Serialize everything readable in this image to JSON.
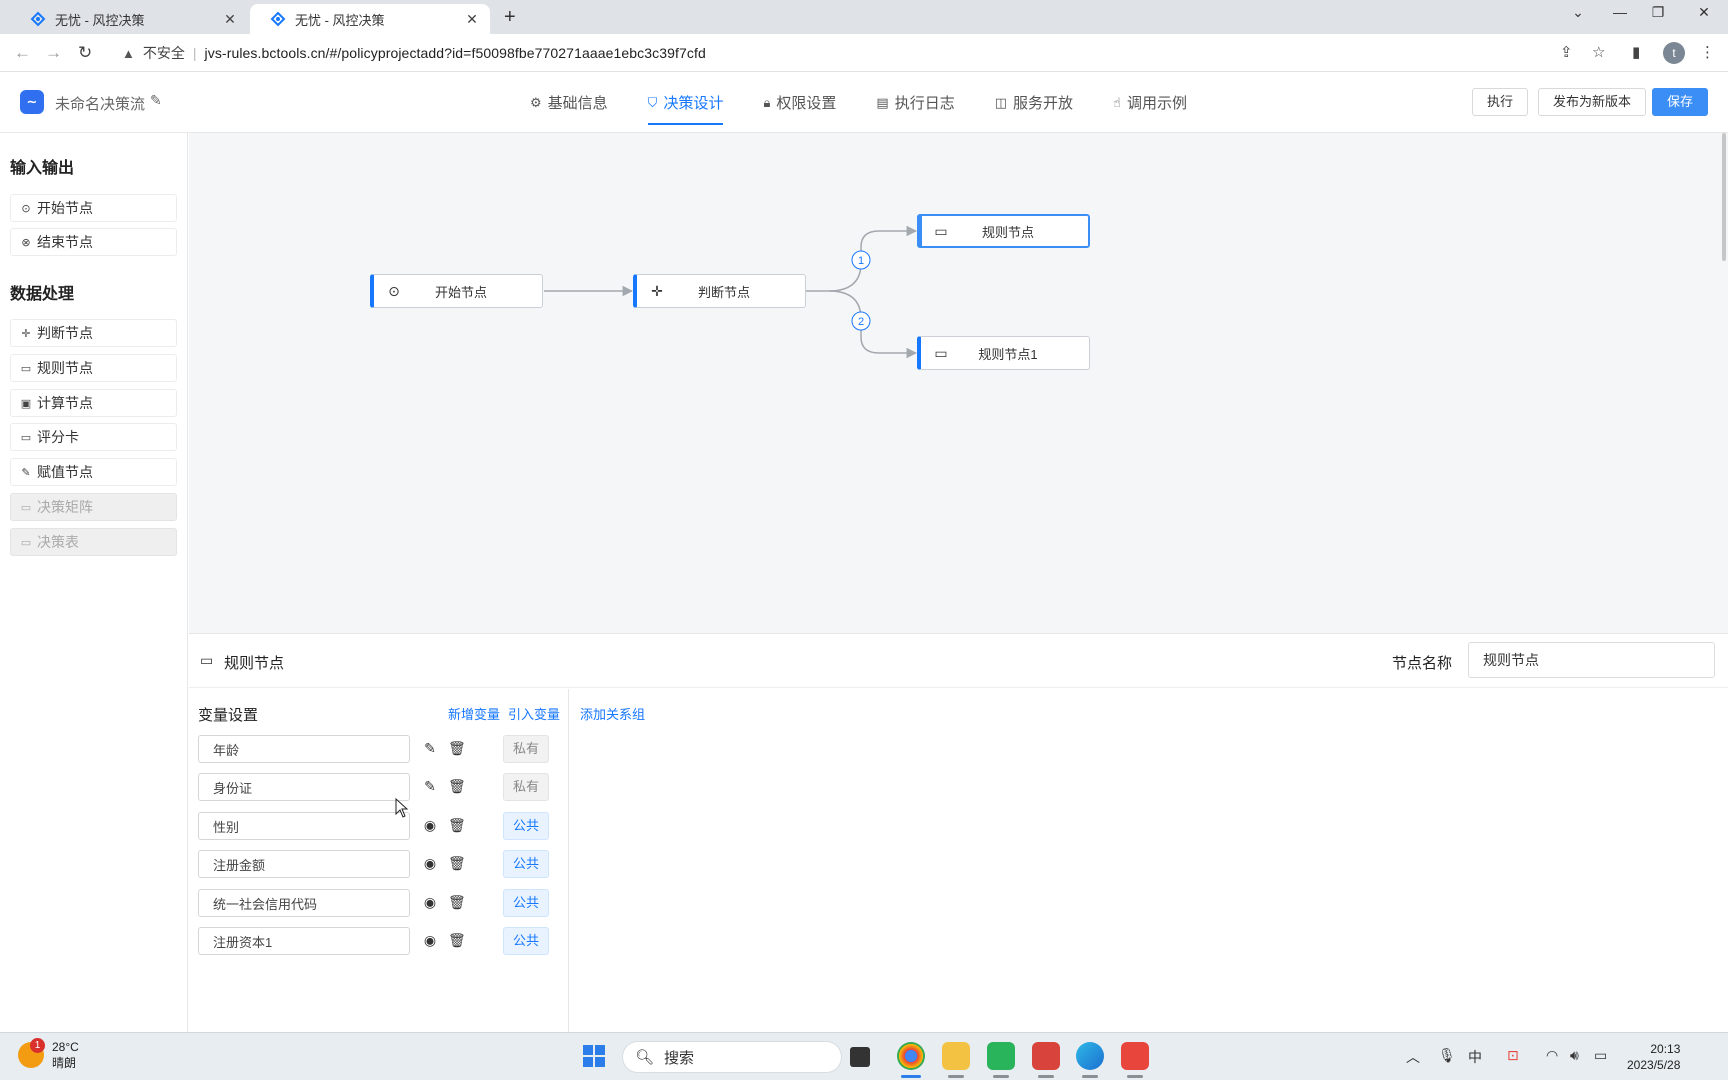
{
  "browser": {
    "tabs": [
      {
        "title": "无忧 - 风控决策",
        "active": false
      },
      {
        "title": "无忧 - 风控决策",
        "active": true
      }
    ],
    "new_tab": "+",
    "security": "不安全",
    "url": "jvs-rules.bctools.cn/#/policyprojectadd?id=f50098fbe770271aaae1ebc3c39f7cfd",
    "profile_initial": "t"
  },
  "header": {
    "logo": "∼",
    "title": "未命名决策流",
    "tabs": [
      {
        "label": "基础信息",
        "icon": "gear-icon",
        "active": false
      },
      {
        "label": "决策设计",
        "icon": "design-icon",
        "active": true
      },
      {
        "label": "权限设置",
        "icon": "lock-icon",
        "active": false
      },
      {
        "label": "执行日志",
        "icon": "doc-icon",
        "active": false
      },
      {
        "label": "服务开放",
        "icon": "book-icon",
        "active": false
      },
      {
        "label": "调用示例",
        "icon": "hand-icon",
        "active": false
      }
    ],
    "buttons": {
      "execute": "执行",
      "publish": "发布为新版本",
      "save": "保存"
    }
  },
  "palette": {
    "groups": [
      {
        "title": "输入输出",
        "items": [
          {
            "label": "开始节点",
            "icon": "play-circle-icon",
            "disabled": false
          },
          {
            "label": "结束节点",
            "icon": "close-circle-icon",
            "disabled": false
          }
        ]
      },
      {
        "title": "数据处理",
        "items": [
          {
            "label": "判断节点",
            "icon": "move-icon",
            "disabled": false
          },
          {
            "label": "规则节点",
            "icon": "card-icon",
            "disabled": false
          },
          {
            "label": "计算节点",
            "icon": "calculator-icon",
            "disabled": false
          },
          {
            "label": "评分卡",
            "icon": "card-icon",
            "disabled": false
          },
          {
            "label": "赋值节点",
            "icon": "edit-icon",
            "disabled": false
          },
          {
            "label": "决策矩阵",
            "icon": "card-icon",
            "disabled": true
          },
          {
            "label": "决策表",
            "icon": "card-icon",
            "disabled": true
          }
        ]
      }
    ]
  },
  "flow": {
    "nodes": [
      {
        "id": "start",
        "label": "开始节点",
        "icon": "play-circle-icon"
      },
      {
        "id": "judge",
        "label": "判断节点",
        "icon": "move-icon"
      },
      {
        "id": "rule",
        "label": "规则节点",
        "icon": "card-icon",
        "selected": true
      },
      {
        "id": "rule1",
        "label": "规则节点1",
        "icon": "card-icon"
      }
    ],
    "branch_labels": [
      "1",
      "2"
    ]
  },
  "panel": {
    "title": "规则节点",
    "node_name_label": "节点名称",
    "node_name_value": "规则节点",
    "var_title": "变量设置",
    "add_var": "新增变量",
    "import_var": "引入变量",
    "add_relation_group": "添加关系组",
    "variables": [
      {
        "name": "年龄",
        "scope": "私有",
        "action": "edit-icon"
      },
      {
        "name": "身份证",
        "scope": "私有",
        "action": "edit-icon"
      },
      {
        "name": "性别",
        "scope": "公共",
        "action": "eye-icon"
      },
      {
        "name": "注册金额",
        "scope": "公共",
        "action": "eye-icon"
      },
      {
        "name": "统一社会信用代码",
        "scope": "公共",
        "action": "eye-icon"
      },
      {
        "name": "注册资本1",
        "scope": "公共",
        "action": "eye-icon"
      }
    ]
  },
  "taskbar": {
    "weather_temp": "28°C",
    "weather_text": "晴朗",
    "weather_badge": "1",
    "search_placeholder": "搜索",
    "ime": "中",
    "time": "20:13",
    "date": "2023/5/28"
  },
  "colors": {
    "accent": "#1677ff",
    "primary_button": "#3a8ef6",
    "canvas_bg": "#f5f6f8"
  }
}
